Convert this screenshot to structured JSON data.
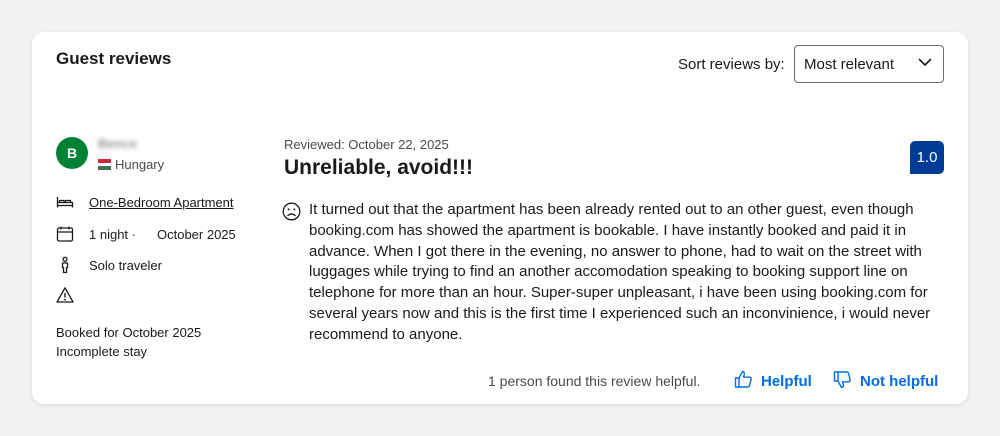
{
  "section": {
    "title": "Guest reviews",
    "sort_label": "Sort reviews by:",
    "sort_value": "Most relevant"
  },
  "reviewer": {
    "initial": "B",
    "name": "Bence",
    "country": "Hungary",
    "room_type": "One-Bedroom Apartment",
    "nights": "1 night ·",
    "stay_date": "October 2025",
    "traveler_type": "Solo traveler",
    "booked_for": "Booked for October 2025",
    "stay_status": "Incomplete stay"
  },
  "review": {
    "reviewed_date": "Reviewed: October 22, 2025",
    "title": "Unreliable, avoid!!!",
    "score": "1.0",
    "text": "It turned out that the apartment has been already rented out to an other guest, even though booking.com has showed the apartment is bookable. I have instantly booked and paid it in advance. When I got there in the evening, no answer to phone, had to wait on the street with luggages while trying to find an another accomodation speaking to booking support line on telephone for more than an hour. Super-super unpleasant, i have been using booking.com for several years now and this is the first time I experienced such an inconvinience, i would never recommend to anyone."
  },
  "feedback": {
    "helpful_count_text": "1 person found this review helpful.",
    "helpful_label": "Helpful",
    "not_helpful_label": "Not helpful"
  },
  "colors": {
    "avatar": "#008234",
    "score_badge": "#003b95",
    "link_blue": "#006ce4",
    "flag": [
      "#ce2939",
      "#ffffff",
      "#477050"
    ]
  }
}
